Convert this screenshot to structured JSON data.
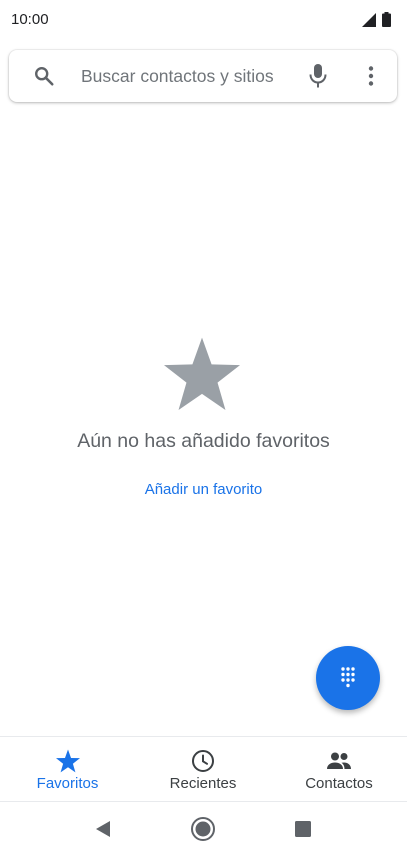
{
  "status_bar": {
    "time": "10:00",
    "icons": [
      "signal-icon",
      "battery-icon"
    ]
  },
  "search": {
    "placeholder": "Buscar contactos y sitios",
    "value": "",
    "icons": [
      "search-icon",
      "mic-icon",
      "more-vert-icon"
    ]
  },
  "empty_state": {
    "icon": "star-icon",
    "message": "Aún no has añadido favoritos",
    "action_label": "Añadir un favorito"
  },
  "fab": {
    "icon": "dialpad-icon"
  },
  "bottom_nav": {
    "items": [
      {
        "label": "Favoritos",
        "icon": "star-icon",
        "active": true
      },
      {
        "label": "Recientes",
        "icon": "clock-icon",
        "active": false
      },
      {
        "label": "Contactos",
        "icon": "people-icon",
        "active": false
      }
    ]
  },
  "system_nav": {
    "buttons": [
      "back-icon",
      "home-icon",
      "recents-icon"
    ]
  },
  "colors": {
    "accent": "#1a73e8",
    "icon_gray": "#5f6368",
    "star_gray": "#9aa0a6",
    "text_dark": "#202124"
  }
}
